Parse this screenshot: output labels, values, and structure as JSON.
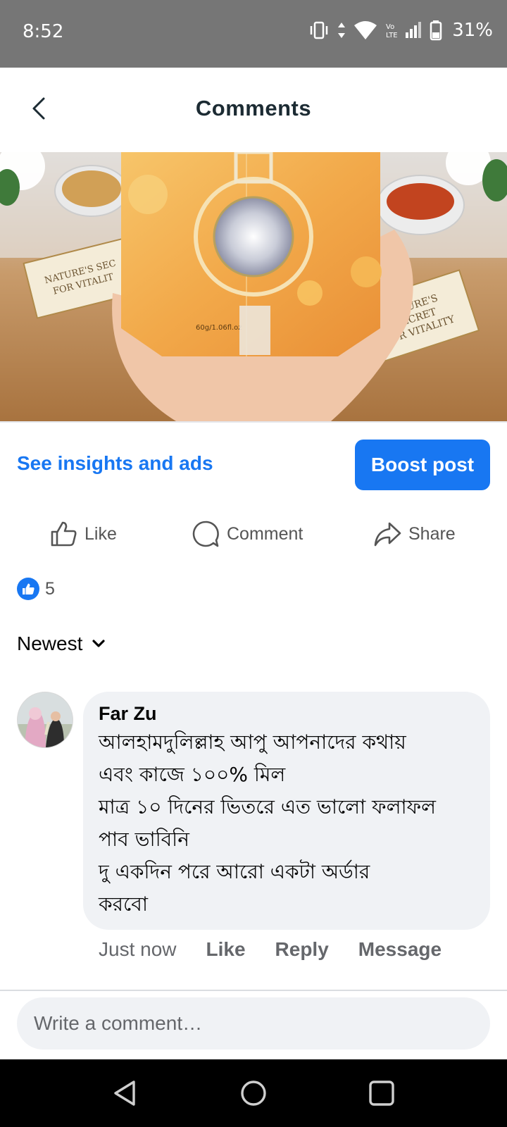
{
  "status_bar": {
    "time": "8:52",
    "battery": "31%",
    "icons": [
      "vibrate-icon",
      "data-arrows-icon",
      "wifi-icon",
      "volte-icon",
      "signal-icon",
      "battery-icon"
    ]
  },
  "header": {
    "title": "Comments",
    "back_icon": "chevron-left-icon"
  },
  "post_image": {
    "card_text_left": "NATURE'S SECRET FOR VITALITY",
    "card_text_right": "NATURE'S SECRET FOR VITALITY",
    "box_label": "60g/1.06fl.oz"
  },
  "post_actions": {
    "insights_link": "See insights and ads",
    "boost_button": "Boost post",
    "like": "Like",
    "comment": "Comment",
    "share": "Share"
  },
  "reactions": {
    "count": "5",
    "icon": "like-reaction-icon"
  },
  "sort": {
    "label": "Newest",
    "icon": "chevron-down-icon"
  },
  "comment": {
    "author": "Far Zu",
    "lines": [
      "আলহামদুলিল্লাহ আপু আপনাদের কথায়",
      "এবং কাজে ১০০% মিল",
      "মাত্র ১০ দিনের ভিতরে এত ভালো ফলাফল",
      "পাব ভাবিনি",
      "দু একদিন পরে আরো একটা অর্ডার",
      "করবো"
    ],
    "time": "Just now",
    "like": "Like",
    "reply": "Reply",
    "message": "Message"
  },
  "composer": {
    "placeholder": "Write a comment…"
  },
  "nav_bar": {
    "icons": [
      "back-triangle-icon",
      "home-circle-icon",
      "recents-square-icon"
    ]
  },
  "colors": {
    "accent": "#1877f2",
    "status_bar": "#767676",
    "bubble": "#f0f2f5"
  }
}
